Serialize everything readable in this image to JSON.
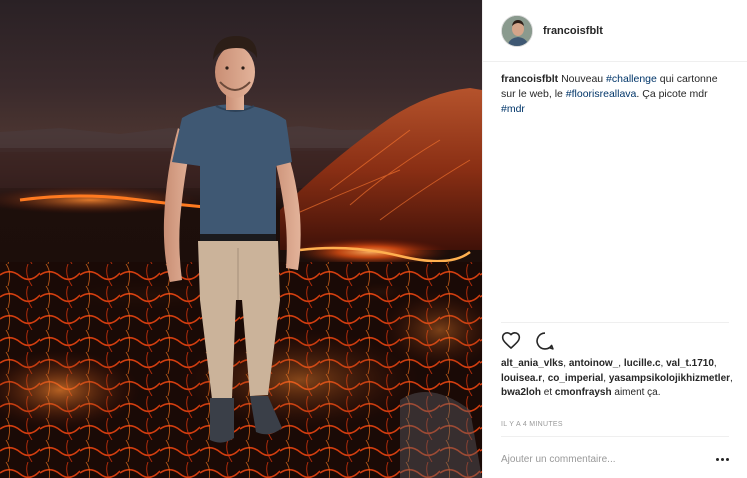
{
  "post": {
    "username": "francoisfblt",
    "caption": {
      "user": "francoisfblt",
      "text_1": " Nouveau ",
      "tag_1": "#challenge",
      "text_2": " qui cartonne sur le web, le ",
      "tag_2": "#floorisreallava",
      "text_3": ". Ça picote mdr ",
      "tag_3": "#mdr"
    },
    "likes": {
      "names": [
        "alt_ania_vlks",
        "antoinow_",
        "lucille.c",
        "val_t.1710",
        "louisea.r",
        "co_imperial",
        "yasampsikolojikhizmetler",
        "bwa2loh",
        "cmonfraysh"
      ],
      "sep": ", ",
      "and": " et ",
      "suffix": " aiment ça."
    },
    "timestamp": "IL Y A 4 MINUTES",
    "comment": {
      "placeholder": "Ajouter un commentaire..."
    }
  },
  "icons": {
    "like": "heart-icon",
    "comment": "comment-icon",
    "more": "more-options-icon"
  },
  "colors": {
    "hashtag": "#003569",
    "text": "#262626",
    "muted": "#999999",
    "lava": "#ff5a14"
  }
}
